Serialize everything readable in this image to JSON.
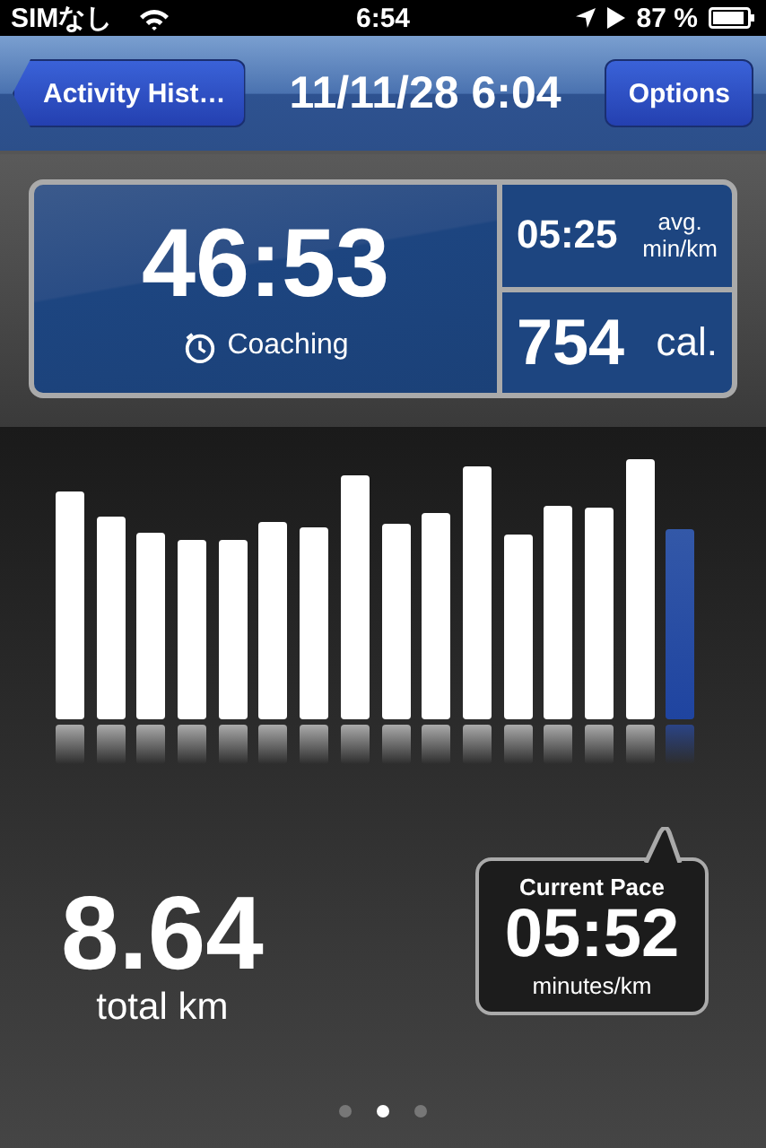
{
  "status_bar": {
    "carrier": "SIMなし",
    "time": "6:54",
    "battery": "87 %"
  },
  "nav": {
    "back": "Activity Hist…",
    "title": "11/11/28 6:04",
    "action": "Options"
  },
  "summary": {
    "duration": "46:53",
    "mode": "Coaching",
    "avg_pace": "05:25",
    "avg_label": "avg.",
    "avg_unit": "min/km",
    "calories": "754",
    "calories_unit": "cal."
  },
  "splits": [
    {
      "selected": false
    },
    {
      "selected": false
    },
    {
      "selected": false
    },
    {
      "selected": false
    },
    {
      "selected": false
    },
    {
      "selected": false
    },
    {
      "selected": false
    },
    {
      "selected": false
    },
    {
      "selected": false
    },
    {
      "selected": false
    },
    {
      "selected": false
    },
    {
      "selected": false
    },
    {
      "selected": false
    },
    {
      "selected": false
    },
    {
      "selected": false
    },
    {
      "selected": true
    }
  ],
  "distance": {
    "value": "8.64",
    "unit": "total km"
  },
  "current_pace": {
    "title": "Current Pace",
    "value": "05:52",
    "unit": "minutes/km"
  },
  "pages": [
    {
      "selected": false
    },
    {
      "selected": true
    },
    {
      "selected": false
    }
  ]
}
